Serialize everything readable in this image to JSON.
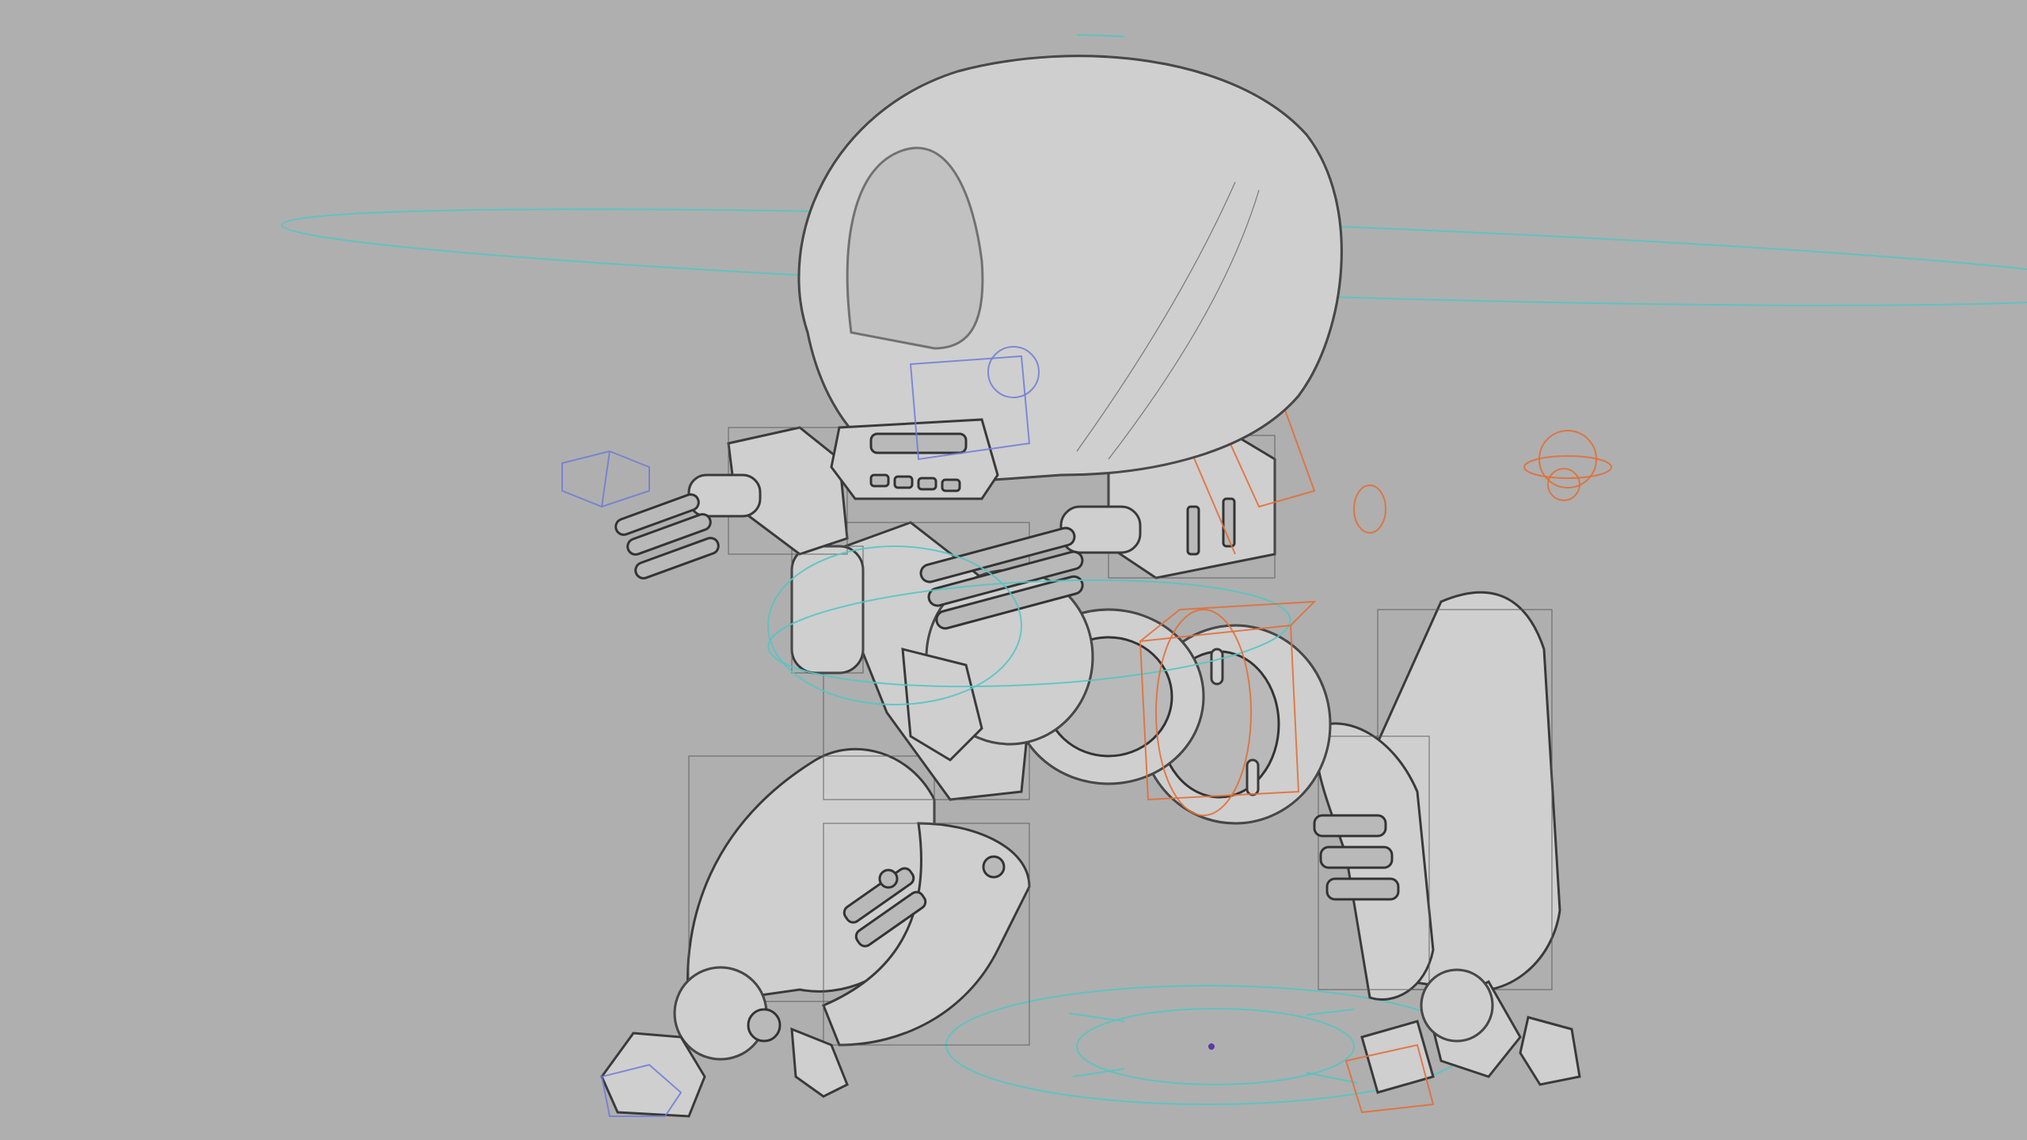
{
  "scene": {
    "background_color": "#afafaf",
    "subject": "robot-walker-wireframe",
    "rig_colors": {
      "cyan": "#59c3c3",
      "orange": "#e0703a",
      "blue": "#6f7bd6"
    }
  }
}
